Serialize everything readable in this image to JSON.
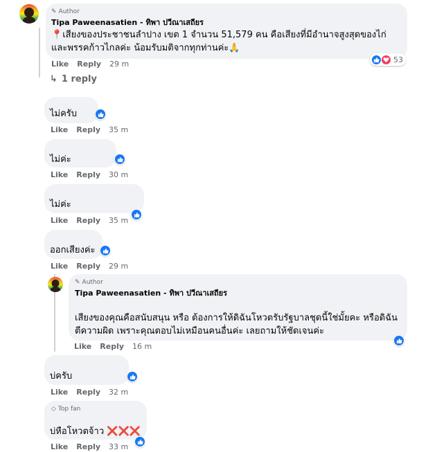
{
  "colors": {
    "accent": "#1877f2",
    "heart": "#f33e58",
    "bubble": "#f0f2f5",
    "meta": "#65676b"
  },
  "actions": {
    "like": "Like",
    "reply": "Reply"
  },
  "reactions": {
    "icons": [
      "like-icon",
      "heart-icon"
    ]
  },
  "top_comment": {
    "badge": "Author",
    "author": "Tipa Paweenasatien - ทิพา ปวีณาเสถียร",
    "pin_emoji": "📍",
    "text": "เสียงของประชาชนลำปาง เขต 1 จำนวน 51,579 คน คือเสียงที่มีอำนาจสูงสุดของไก่ และพรรคก้าวไกลค่ะ น้อมรับมติจากทุกท่านค่ะ🙏",
    "reaction_count": "53",
    "time": "29 m",
    "replies_link": "1 reply"
  },
  "comments": [
    {
      "text": "ไม่ครับ",
      "time": "35 m"
    },
    {
      "text": "ไม่ค่ะ",
      "time": "30 m"
    },
    {
      "text": "ไม่ค่ะ",
      "time": "35 m"
    },
    {
      "text": "ออกเสียงค่ะ",
      "time": "29 m"
    }
  ],
  "author_reply": {
    "badge": "Author",
    "author": "Tipa Paweenasatien - ทิพา ปวีณาเสถียร",
    "text": "เสียงของคุณคือสนับสนุน หรือ ต้องการให้ดิฉันโหวตรับรัฐบาลชุดนี้ใช่มั้ยคะ หรือดิฉันตีความผิด เพราะคุณตอบไม่เหมือนคนอื่นค่ะ เลยถามให้ชัดเจนค่ะ",
    "time": "16 m"
  },
  "bottom_comments": [
    {
      "text": "บ่ครับ",
      "time": "32 m"
    },
    {
      "badge": "Top fan",
      "text": "บ่หือโหวตจ้าว ❌❌❌",
      "time": "33 m"
    }
  ]
}
